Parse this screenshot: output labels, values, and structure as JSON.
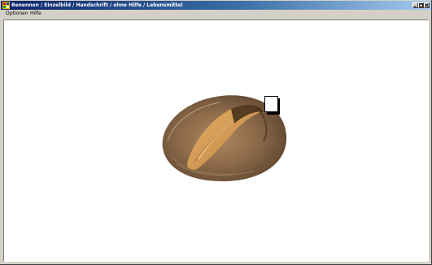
{
  "window": {
    "title": "Benennen / Einzelbild / Handschrift / ohne Hilfe / Lebensmittel"
  },
  "menu": {
    "items": [
      "Optionen",
      "Hilfe"
    ]
  },
  "stimulus": {
    "image_name": "bread-loaf",
    "answer_field_value": ""
  },
  "colors": {
    "title_start": "#0a246a",
    "title_end": "#a6caf0",
    "window_face": "#d4d0c8",
    "canvas": "#ffffff"
  }
}
